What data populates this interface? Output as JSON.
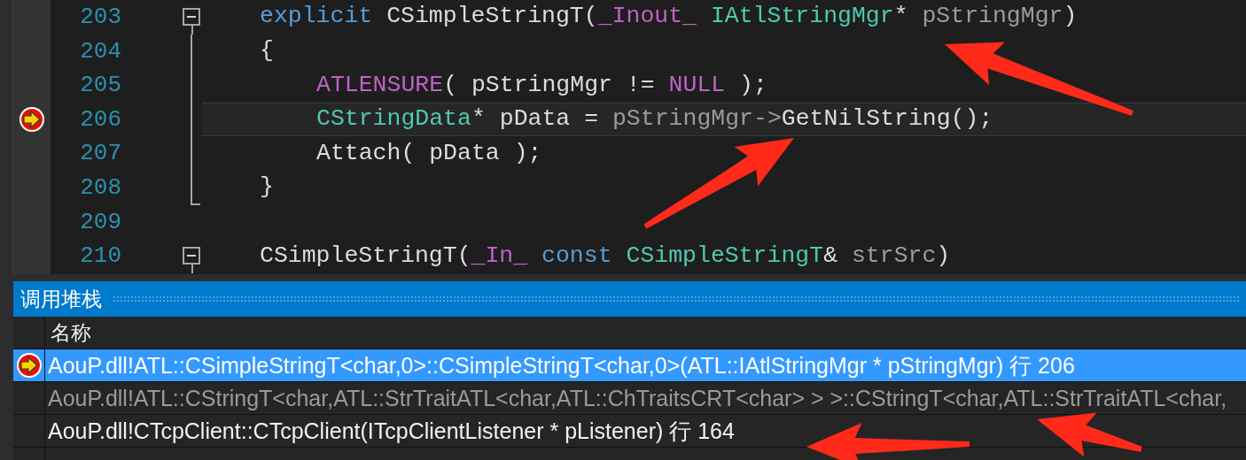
{
  "editor": {
    "lines": [
      {
        "number": "203",
        "collapse_button": true,
        "block_end": false,
        "indented": false,
        "current": false,
        "tokens": [
          {
            "text": "explicit ",
            "kind": "keyword"
          },
          {
            "text": "CSimpleStringT(",
            "kind": "plain"
          },
          {
            "text": "_Inout_ ",
            "kind": "macro"
          },
          {
            "text": "IAtlStringMgr",
            "kind": "type"
          },
          {
            "text": "* ",
            "kind": "plain"
          },
          {
            "text": "pStringMgr",
            "kind": "param"
          },
          {
            "text": ")",
            "kind": "plain"
          }
        ]
      },
      {
        "number": "204",
        "collapse_button": false,
        "block_end": false,
        "indented": false,
        "current": false,
        "tokens": [
          {
            "text": "{",
            "kind": "plain"
          }
        ]
      },
      {
        "number": "205",
        "collapse_button": false,
        "block_end": false,
        "indented": true,
        "current": false,
        "tokens": [
          {
            "text": "ATLENSURE",
            "kind": "macro"
          },
          {
            "text": "( pStringMgr != ",
            "kind": "plain"
          },
          {
            "text": "NULL",
            "kind": "macro"
          },
          {
            "text": " );",
            "kind": "plain"
          }
        ]
      },
      {
        "number": "206",
        "collapse_button": false,
        "block_end": false,
        "indented": true,
        "current": true,
        "tokens": [
          {
            "text": "CStringData",
            "kind": "type"
          },
          {
            "text": "* pData = ",
            "kind": "plain"
          },
          {
            "text": "pStringMgr->",
            "kind": "param"
          },
          {
            "text": "GetNilString();",
            "kind": "plain"
          }
        ]
      },
      {
        "number": "207",
        "collapse_button": false,
        "block_end": false,
        "indented": true,
        "current": false,
        "tokens": [
          {
            "text": "Attach( pData );",
            "kind": "plain"
          }
        ]
      },
      {
        "number": "208",
        "collapse_button": false,
        "block_end": true,
        "indented": false,
        "current": false,
        "tokens": [
          {
            "text": "}",
            "kind": "plain"
          }
        ]
      },
      {
        "number": "209",
        "collapse_button": false,
        "block_end": false,
        "current": false
      },
      {
        "number": "210",
        "collapse_button": true,
        "block_end": false,
        "indented": false,
        "current": false,
        "tokens": [
          {
            "text": "CSimpleStringT(",
            "kind": "plain"
          },
          {
            "text": "_In_ ",
            "kind": "macro"
          },
          {
            "text": "const ",
            "kind": "keyword"
          },
          {
            "text": "CSimpleStringT",
            "kind": "type"
          },
          {
            "text": "& ",
            "kind": "plain"
          },
          {
            "text": "strSrc",
            "kind": "param"
          },
          {
            "text": ")",
            "kind": "plain"
          }
        ]
      }
    ]
  },
  "call_stack": {
    "title": "调用堆栈",
    "columns": [
      "名称"
    ],
    "rows": [
      {
        "text": "AouP.dll!ATL::CSimpleStringT<char,0>::CSimpleStringT<char,0>(ATL::IAtlStringMgr * pStringMgr) 行 206",
        "selected": true,
        "current": true,
        "greyed": false
      },
      {
        "text": "AouP.dll!ATL::CStringT<char,ATL::StrTraitATL<char,ATL::ChTraitsCRT<char> > >::CStringT<char,ATL::StrTraitATL<char,",
        "selected": false,
        "current": false,
        "greyed": true
      },
      {
        "text": "AouP.dll!CTcpClient::CTcpClient(ITcpClientListener * pListener) 行 164",
        "selected": false,
        "current": false,
        "greyed": false
      }
    ]
  }
}
